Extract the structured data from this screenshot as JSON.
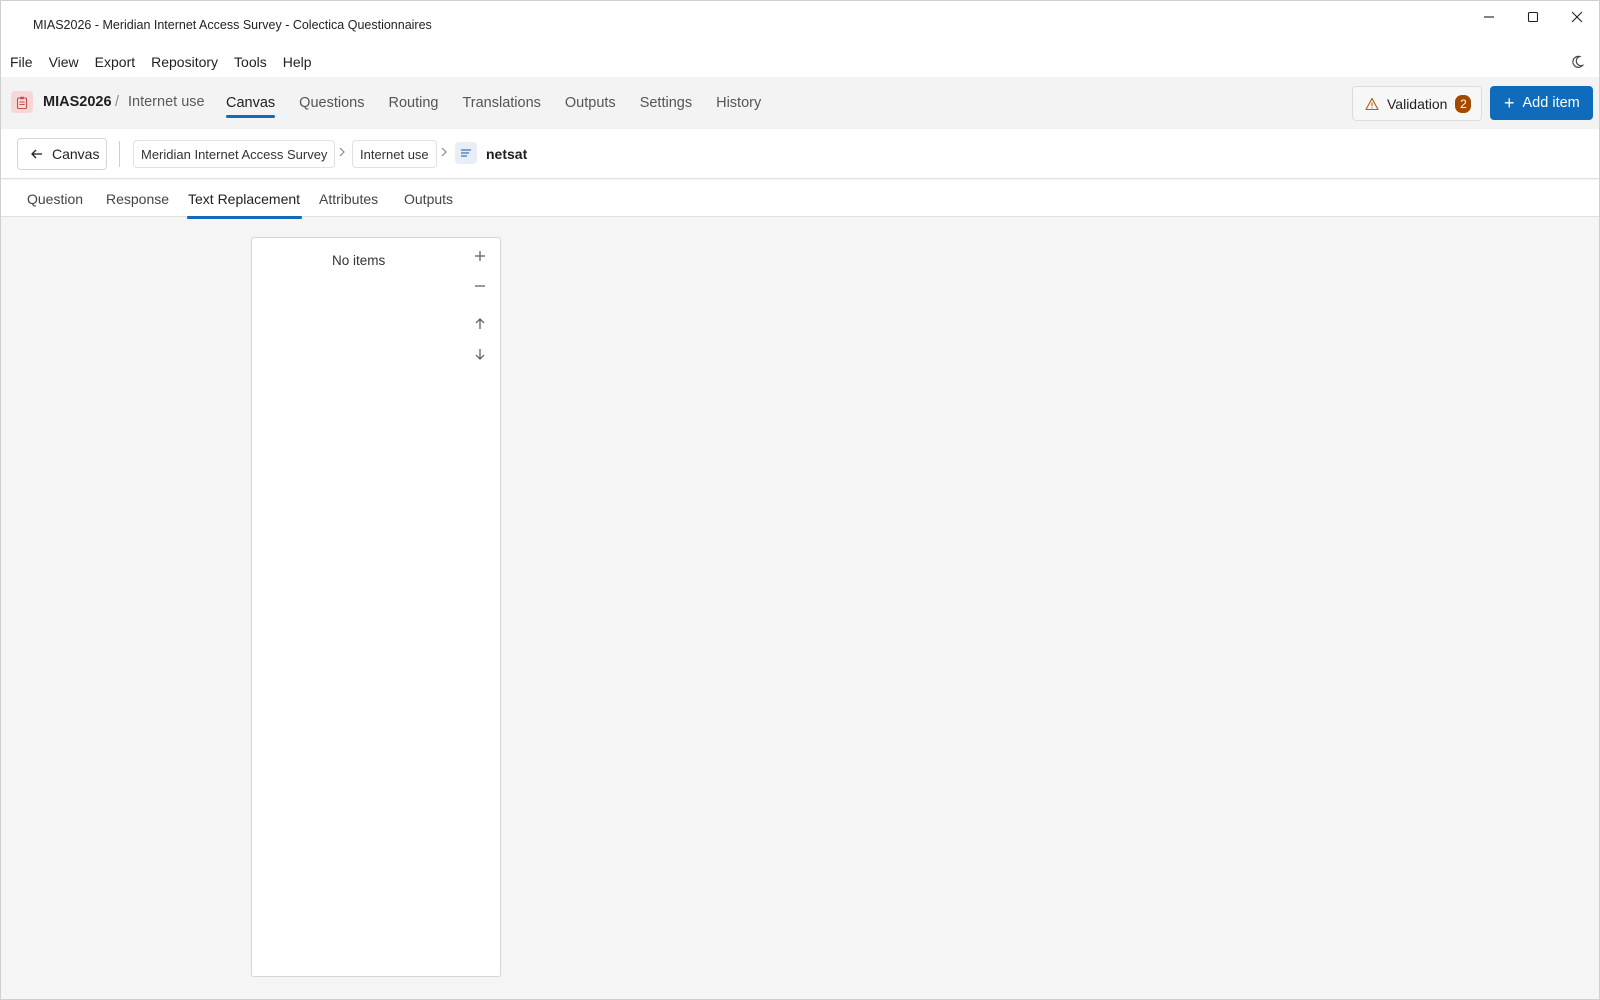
{
  "window": {
    "title": "MIAS2026 - Meridian Internet Access Survey - Colectica Questionnaires",
    "controls": [
      "minimize-icon",
      "maximize-icon",
      "close-icon"
    ]
  },
  "menu": {
    "items": [
      "File",
      "View",
      "Export",
      "Repository",
      "Tools",
      "Help"
    ],
    "theme_icon": "moon-icon"
  },
  "topnav": {
    "project": "MIAS2026",
    "separator": "/",
    "section": "Internet use",
    "tabs": [
      "Canvas",
      "Questions",
      "Routing",
      "Translations",
      "Outputs",
      "Settings",
      "History"
    ],
    "active_tab": "Canvas",
    "validation_label": "Validation",
    "validation_count": "2",
    "add_item_label": "Add item",
    "accent_color": "#0f6cbd",
    "warning_badge_color": "#a34a00"
  },
  "breadcrumb": {
    "back_label": "Canvas",
    "crumbs": [
      "Meridian Internet Access Survey",
      "Internet use"
    ],
    "current": "netsat",
    "current_icon": "text-lines-icon"
  },
  "subtabs": {
    "items": [
      "Question",
      "Response",
      "Text Replacement",
      "Attributes",
      "Outputs"
    ],
    "active": "Text Replacement"
  },
  "panel": {
    "empty_text": "No items",
    "actions": [
      "plus-icon",
      "minus-icon",
      "arrow-up-icon",
      "arrow-down-icon"
    ]
  }
}
